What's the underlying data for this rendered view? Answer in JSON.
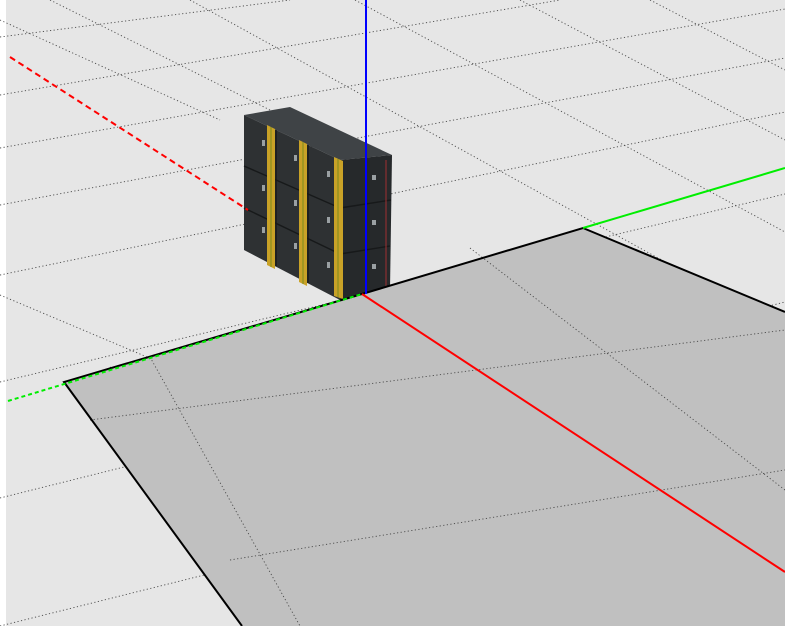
{
  "scene": {
    "colors": {
      "background": "#ffffff",
      "grid_plane": "#e6e6e6",
      "grid_line": "#4a4a4a",
      "floor_patch": "#c0c0c0",
      "floor_outline": "#000000",
      "axis_x": "#ff0000",
      "axis_y": "#00ee00",
      "axis_z": "#0000ff",
      "box_body": "#2e3133",
      "box_top": "#3f4346",
      "box_stripe": "#c9a227",
      "box_stripe_edge": "#7a8a1e",
      "box_panel_dark": "#1a1c1e"
    },
    "axes": [
      "x",
      "y",
      "z"
    ],
    "object": "cargo-box-stack",
    "box_grid": {
      "columns": 3,
      "rows": 3
    }
  }
}
